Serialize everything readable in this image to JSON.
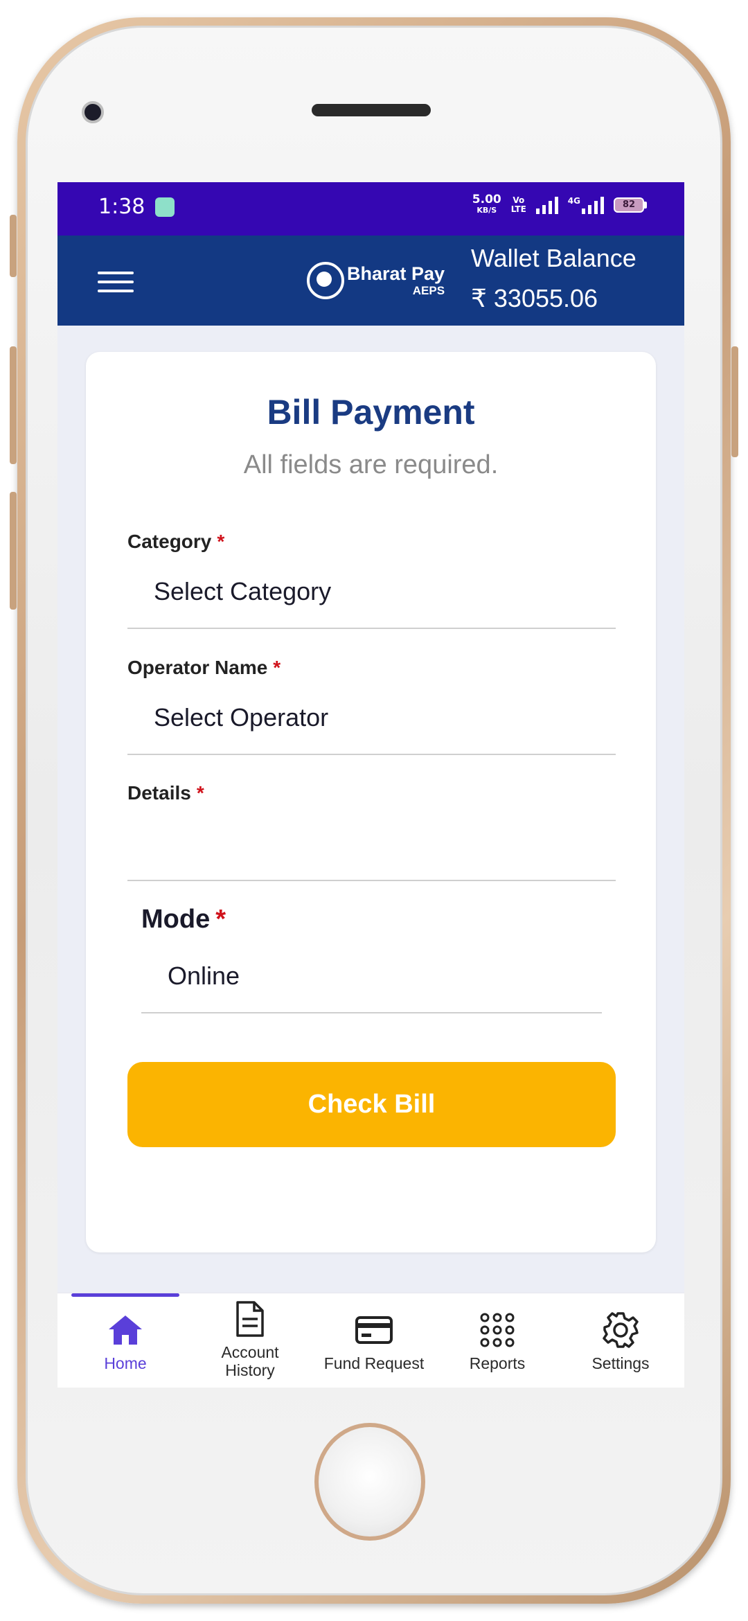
{
  "status_bar": {
    "time": "1:38",
    "speed_value": "5.00",
    "speed_unit": "KB/S",
    "volte_top": "Vo",
    "volte_bottom": "LTE",
    "network_label": "4G",
    "battery_level": "82"
  },
  "header": {
    "logo_title": "Bharat Pay",
    "logo_subtitle": "AEPS",
    "wallet_label": "Wallet Balance",
    "wallet_amount": "₹ 33055.06"
  },
  "form": {
    "title": "Bill Payment",
    "subtitle": "All fields are required.",
    "required_mark": "*",
    "category_label": "Category",
    "category_value": "Select Category",
    "operator_label": "Operator Name",
    "operator_value": "Select Operator",
    "details_label": "Details",
    "details_value": "",
    "mode_label": "Mode",
    "mode_value": "Online",
    "submit_label": "Check Bill"
  },
  "bottom_nav": {
    "items": [
      {
        "label": "Home",
        "icon": "home-icon",
        "active": true
      },
      {
        "label": "Account History",
        "icon": "document-icon",
        "active": false
      },
      {
        "label": "Fund Request",
        "icon": "card-icon",
        "active": false
      },
      {
        "label": "Reports",
        "icon": "grid-icon",
        "active": false
      },
      {
        "label": "Settings",
        "icon": "gear-icon",
        "active": false
      }
    ]
  },
  "colors": {
    "status_bar": "#3507b2",
    "header": "#133983",
    "title": "#1a3b82",
    "button": "#fbb401",
    "active_nav": "#5a3fd9",
    "required": "#d0121b"
  }
}
